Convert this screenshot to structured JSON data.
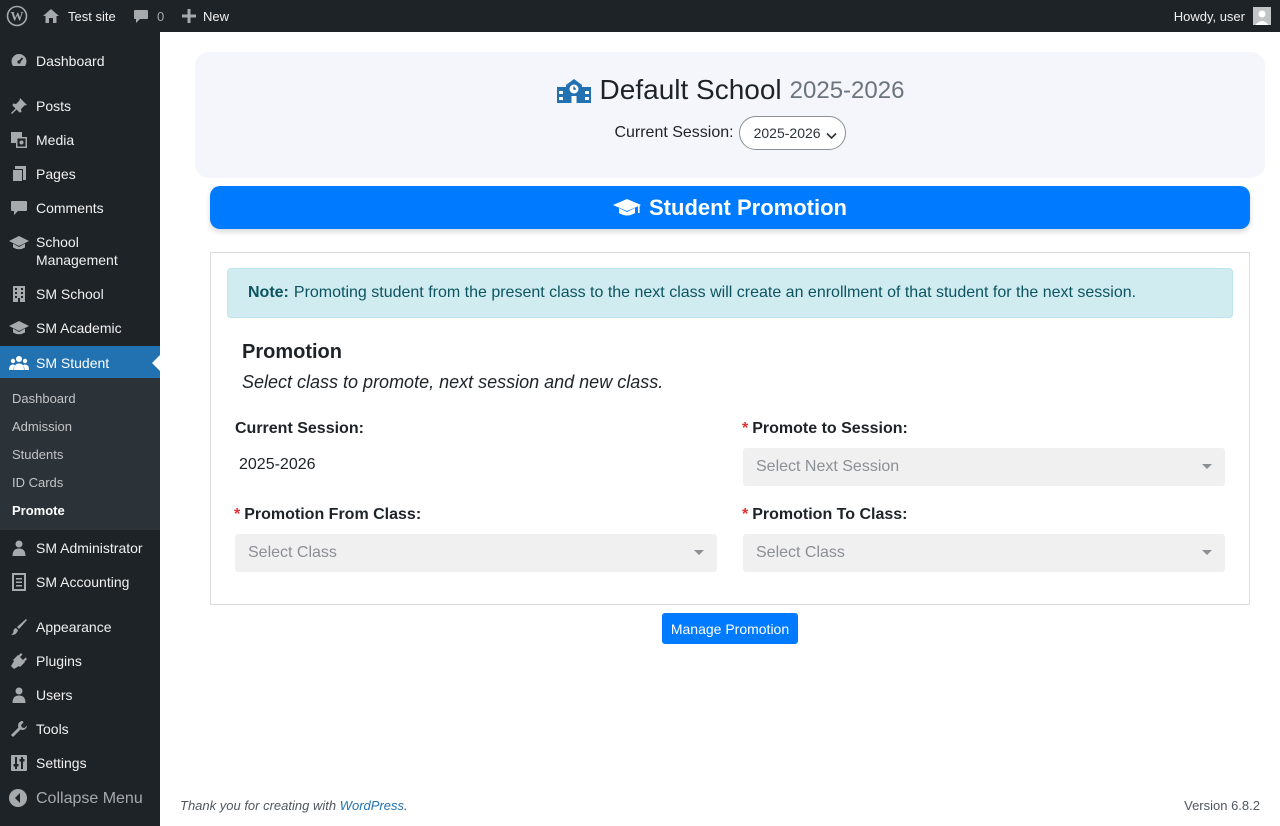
{
  "admin_bar": {
    "site_name": "Test site",
    "comments_count": "0",
    "new_label": "New",
    "greeting": "Howdy, user"
  },
  "sidebar": {
    "items": [
      {
        "label": "Dashboard",
        "icon": "dashboard-icon"
      },
      {
        "label": "Posts",
        "icon": "pin-icon"
      },
      {
        "label": "Media",
        "icon": "media-icon"
      },
      {
        "label": "Pages",
        "icon": "pages-icon"
      },
      {
        "label": "Comments",
        "icon": "comment-icon"
      },
      {
        "label": "School Management",
        "icon": "graduation-cap-icon"
      },
      {
        "label": "SM School",
        "icon": "building-icon"
      },
      {
        "label": "SM Academic",
        "icon": "graduation-cap-icon"
      },
      {
        "label": "SM Student",
        "icon": "users-icon"
      },
      {
        "label": "SM Administrator",
        "icon": "user-icon"
      },
      {
        "label": "SM Accounting",
        "icon": "ledger-icon"
      },
      {
        "label": "Appearance",
        "icon": "brush-icon"
      },
      {
        "label": "Plugins",
        "icon": "plug-icon"
      },
      {
        "label": "Users",
        "icon": "user-icon"
      },
      {
        "label": "Tools",
        "icon": "wrench-icon"
      },
      {
        "label": "Settings",
        "icon": "sliders-icon"
      }
    ],
    "submenu": [
      "Dashboard",
      "Admission",
      "Students",
      "ID Cards",
      "Promote"
    ],
    "collapse_label": "Collapse Menu"
  },
  "school_header": {
    "name": "Default School",
    "session": "2025-2026",
    "current_session_label": "Current Session:",
    "current_session_value": "2025-2026"
  },
  "banner": {
    "title": "Student Promotion"
  },
  "note": {
    "label": "Note:",
    "text": "Promoting student from the present class to the next class will create an enrollment of that student for the next session."
  },
  "promotion": {
    "heading": "Promotion",
    "subheading": "Select class to promote, next session and new class.",
    "current_session_label": "Current Session:",
    "current_session_value": "2025-2026",
    "promote_to_session_label": "Promote to Session:",
    "promote_to_session_placeholder": "Select Next Session",
    "from_class_label": "Promotion From Class:",
    "from_class_placeholder": "Select Class",
    "to_class_label": "Promotion To Class:",
    "to_class_placeholder": "Select Class",
    "required_mark": "*",
    "button_label": "Manage Promotion"
  },
  "footer": {
    "thanks_prefix": "Thank you for creating with ",
    "thanks_link": "WordPress",
    "thanks_suffix": ".",
    "version": "Version 6.8.2"
  },
  "colors": {
    "admin_dark": "#1d2327",
    "wp_blue": "#2271b1",
    "primary": "#007bff",
    "note_bg": "#d1ecf1",
    "required": "#dc3232"
  }
}
